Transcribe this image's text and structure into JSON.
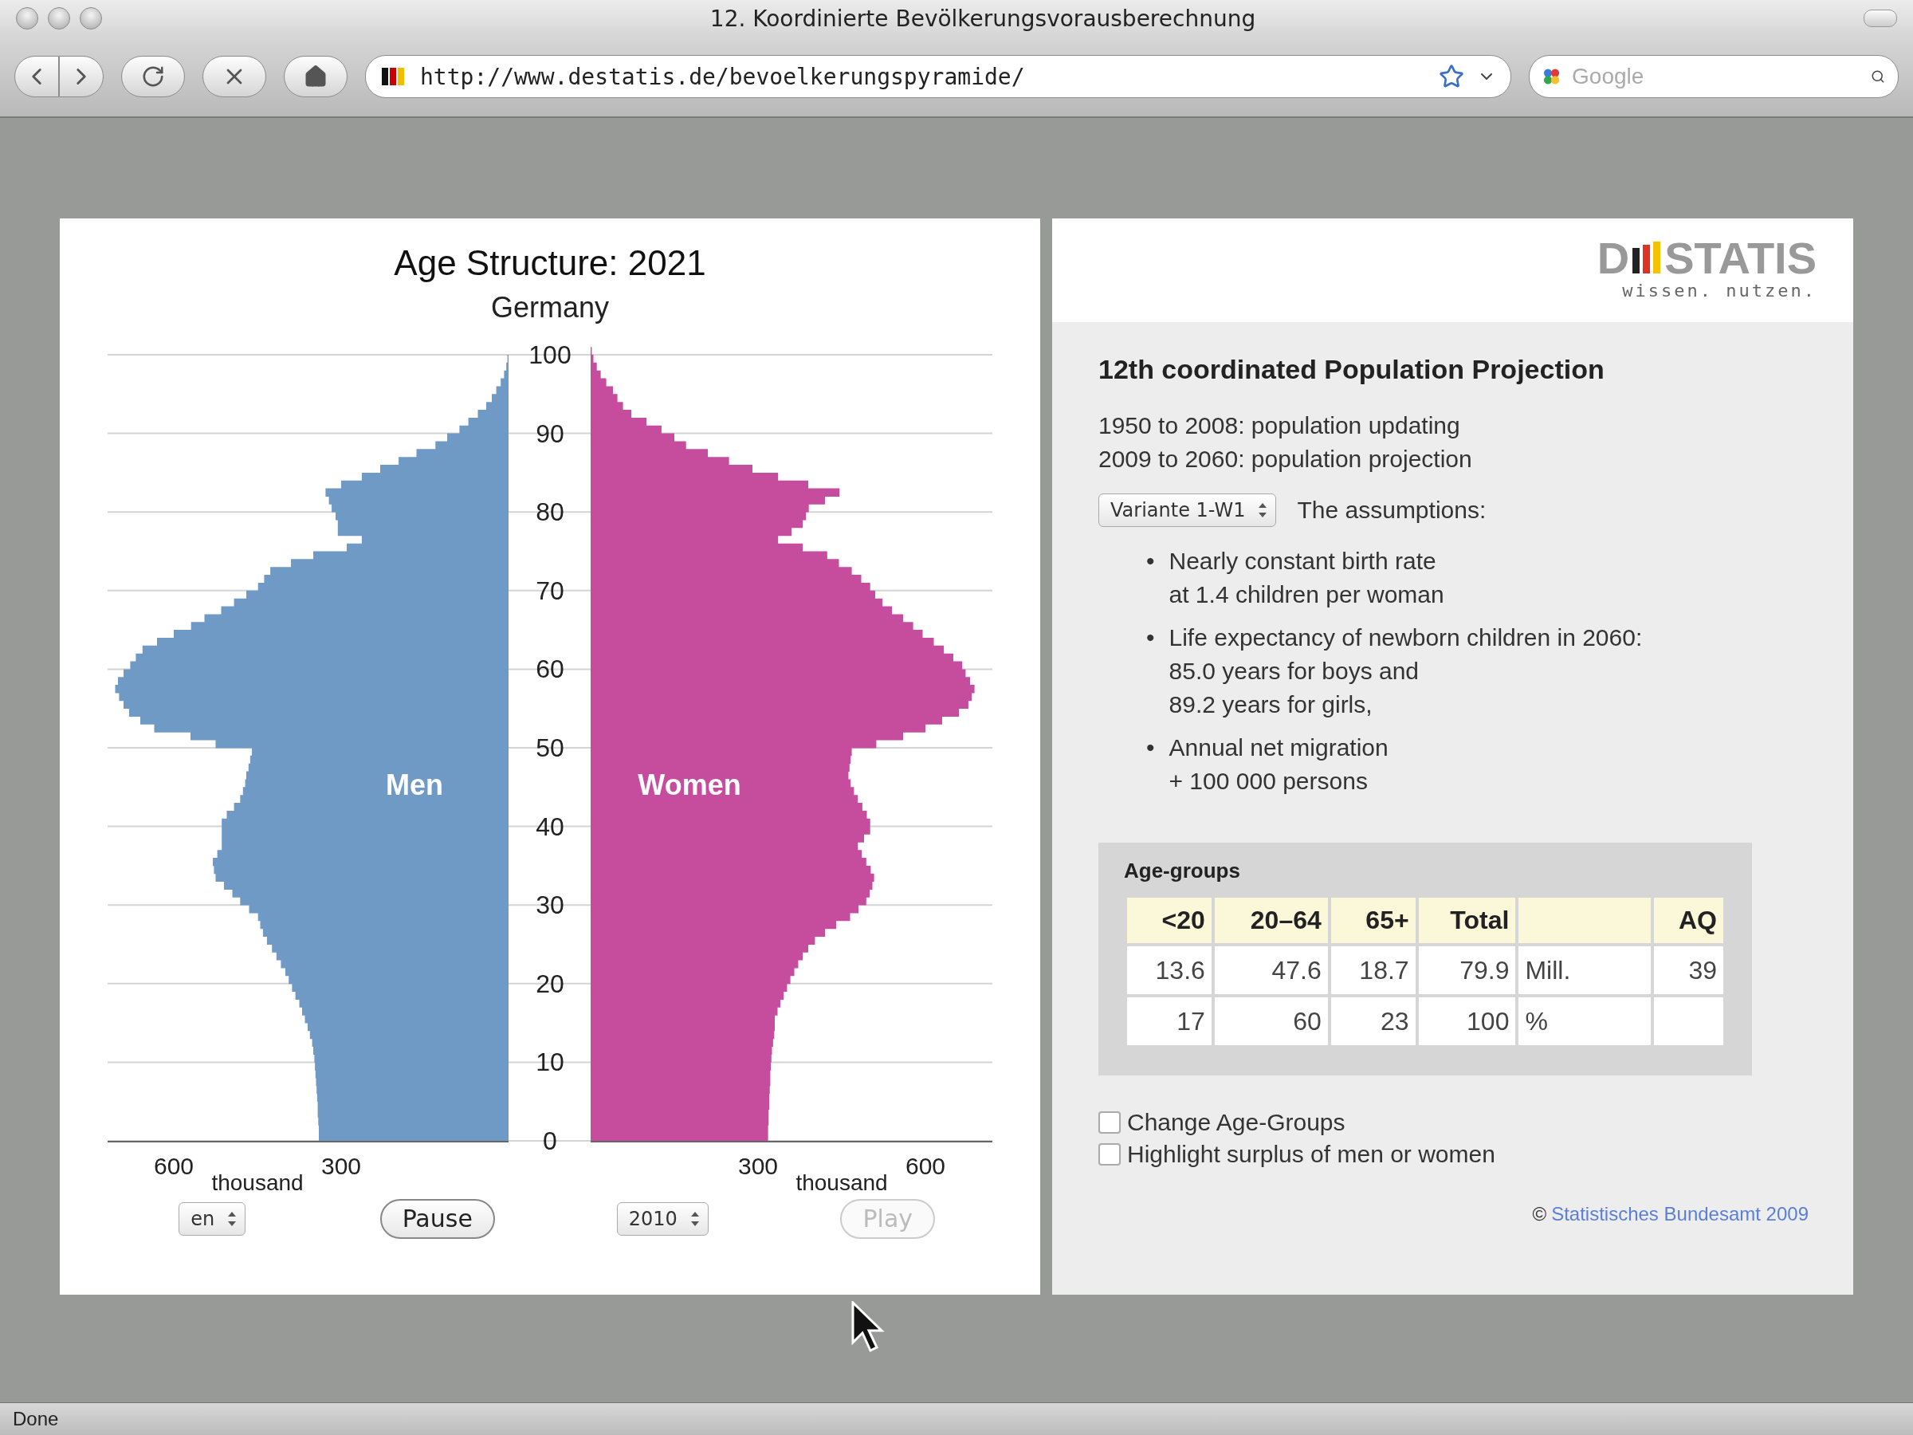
{
  "window": {
    "title": "12. Koordinierte Bevölkerungsvorausberechnung"
  },
  "toolbar": {
    "url": "http://www.destatis.de/bevoelkerungspyramide/",
    "search": {
      "placeholder": "Google"
    }
  },
  "pyramid": {
    "title": "Age Structure: 2021",
    "subtitle": "Germany",
    "age_labels": [
      "100",
      "90",
      "80",
      "70",
      "60",
      "50",
      "40",
      "30",
      "20",
      "10",
      "0"
    ],
    "value_axes": [
      {
        "ticks": [
          "600",
          "300"
        ],
        "unit": "thousand"
      },
      {
        "ticks": [
          "300",
          "600"
        ],
        "unit": "thousand"
      }
    ],
    "series": [
      {
        "name": "Men",
        "color": "#6f9ac6"
      },
      {
        "name": "Women",
        "color": "#c64d9e"
      }
    ],
    "controls": [
      {
        "kind": "select",
        "value": "en"
      },
      {
        "kind": "button",
        "label": "Pause",
        "disabled": false
      },
      {
        "kind": "select",
        "value": "2010"
      },
      {
        "kind": "button",
        "label": "Play",
        "disabled": true
      }
    ]
  },
  "info": {
    "logo": {
      "lead": "D",
      "rest": "STATIS",
      "tagline": "wissen. nutzen."
    },
    "heading": "12th coordinated Population Projection",
    "periods": [
      "1950 to 2008: population updating",
      "2009 to 2060: population projection"
    ],
    "variant": {
      "value": "Variante 1-W1"
    },
    "assumptions_label": "The assumptions:",
    "assumptions": [
      {
        "bullet": "•",
        "lines": [
          "Nearly constant birth rate",
          "at 1.4 children per woman"
        ]
      },
      {
        "bullet": "•",
        "lines": [
          "Life expectancy of newborn children in 2060:",
          "85.0 years for boys and",
          "89.2 years for girls,"
        ]
      },
      {
        "bullet": "•",
        "lines": [
          "Annual net migration",
          "+ 100 000 persons"
        ]
      }
    ],
    "age_groups": {
      "title": "Age-groups",
      "columns": [
        "<20",
        "20–64",
        "65+",
        "Total",
        "AQ"
      ],
      "rows": [
        {
          "values": [
            "13.6",
            "47.6",
            "18.7",
            "79.9"
          ],
          "unit": "Mill.",
          "aq": "39"
        },
        {
          "values": [
            "17",
            "60",
            "23",
            "100"
          ],
          "unit": "%"
        }
      ]
    },
    "options": [
      {
        "label": "Change Age-Groups",
        "checked": false
      },
      {
        "label": "Highlight surplus of men or women",
        "checked": false
      }
    ],
    "copyright": {
      "symbol": "©",
      "link": "Statistisches Bundesamt 2009"
    }
  },
  "status_bar": {
    "text": "Done"
  }
}
